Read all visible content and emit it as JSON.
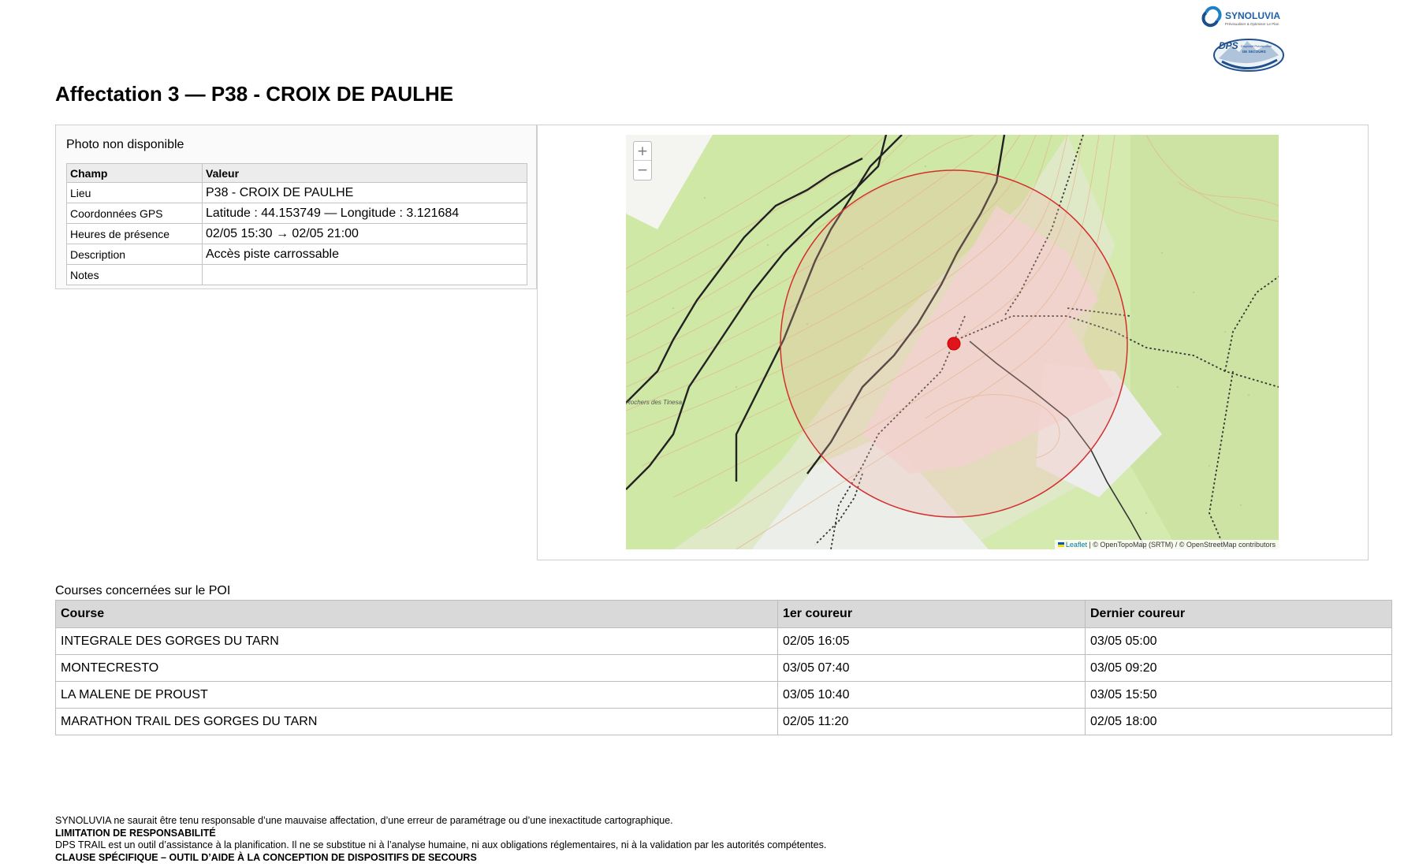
{
  "logo": {
    "brand": "SYNOLUVIA",
    "brand_tagline": "Prévisualiser & Optimiser Le Plan",
    "badge": "DPS",
    "badge_sub": "Dispositif Prévisionnel",
    "badge_sub2": "DE SECOURS"
  },
  "title": "Affectation 3 — P38 - CROIX DE PAULHE",
  "photo_status": "Photo non disponible",
  "info": {
    "col_field": "Champ",
    "col_value": "Valeur",
    "rows": [
      {
        "field": "Lieu",
        "value": "P38 - CROIX DE PAULHE"
      },
      {
        "field": "Coordonnées GPS",
        "value": "Latitude : 44.153749 — Longitude : 3.121684"
      },
      {
        "field": "Heures de présence",
        "value": "02/05 15:30 → 02/05 21:00"
      },
      {
        "field": "Description",
        "value": "Accès piste carrossable"
      },
      {
        "field": "Notes",
        "value": ""
      }
    ]
  },
  "map": {
    "zoom_in": "+",
    "zoom_out": "−",
    "place_label": "Rochers des Tinesa",
    "attribution_link": "Leaflet",
    "attribution_text": " | © OpenTopoMap (SRTM) / © OpenStreetMap contributors",
    "marker_color": "#e0151b",
    "circle_color": "#d32f2f"
  },
  "courses": {
    "caption": "Courses concernées sur le POI",
    "headers": [
      "Course",
      "1er coureur",
      "Dernier coureur"
    ],
    "rows": [
      [
        "INTEGRALE DES GORGES DU TARN",
        "02/05 16:05",
        "03/05 05:00"
      ],
      [
        "MONTECRESTO",
        "03/05 07:40",
        "03/05 09:20"
      ],
      [
        "LA MALENE DE PROUST",
        "03/05 10:40",
        "03/05 15:50"
      ],
      [
        "MARATHON TRAIL DES GORGES DU TARN",
        "02/05 11:20",
        "02/05 18:00"
      ]
    ]
  },
  "footer": {
    "line1": "SYNOLUVIA ne saurait être tenu responsable d’une mauvaise affectation, d’une erreur de paramétrage ou d’une inexactitude cartographique.",
    "line2": "LIMITATION DE RESPONSABILITÉ",
    "line3": "DPS TRAIL est un outil d’assistance à la planification. Il ne se substitue ni à l’analyse humaine, ni aux obligations réglementaires, ni à la validation par les autorités compétentes.",
    "line4": "CLAUSE SPÉCIFIQUE – OUTIL D’AIDE À LA CONCEPTION DE DISPOSITIFS DE SECOURS"
  }
}
